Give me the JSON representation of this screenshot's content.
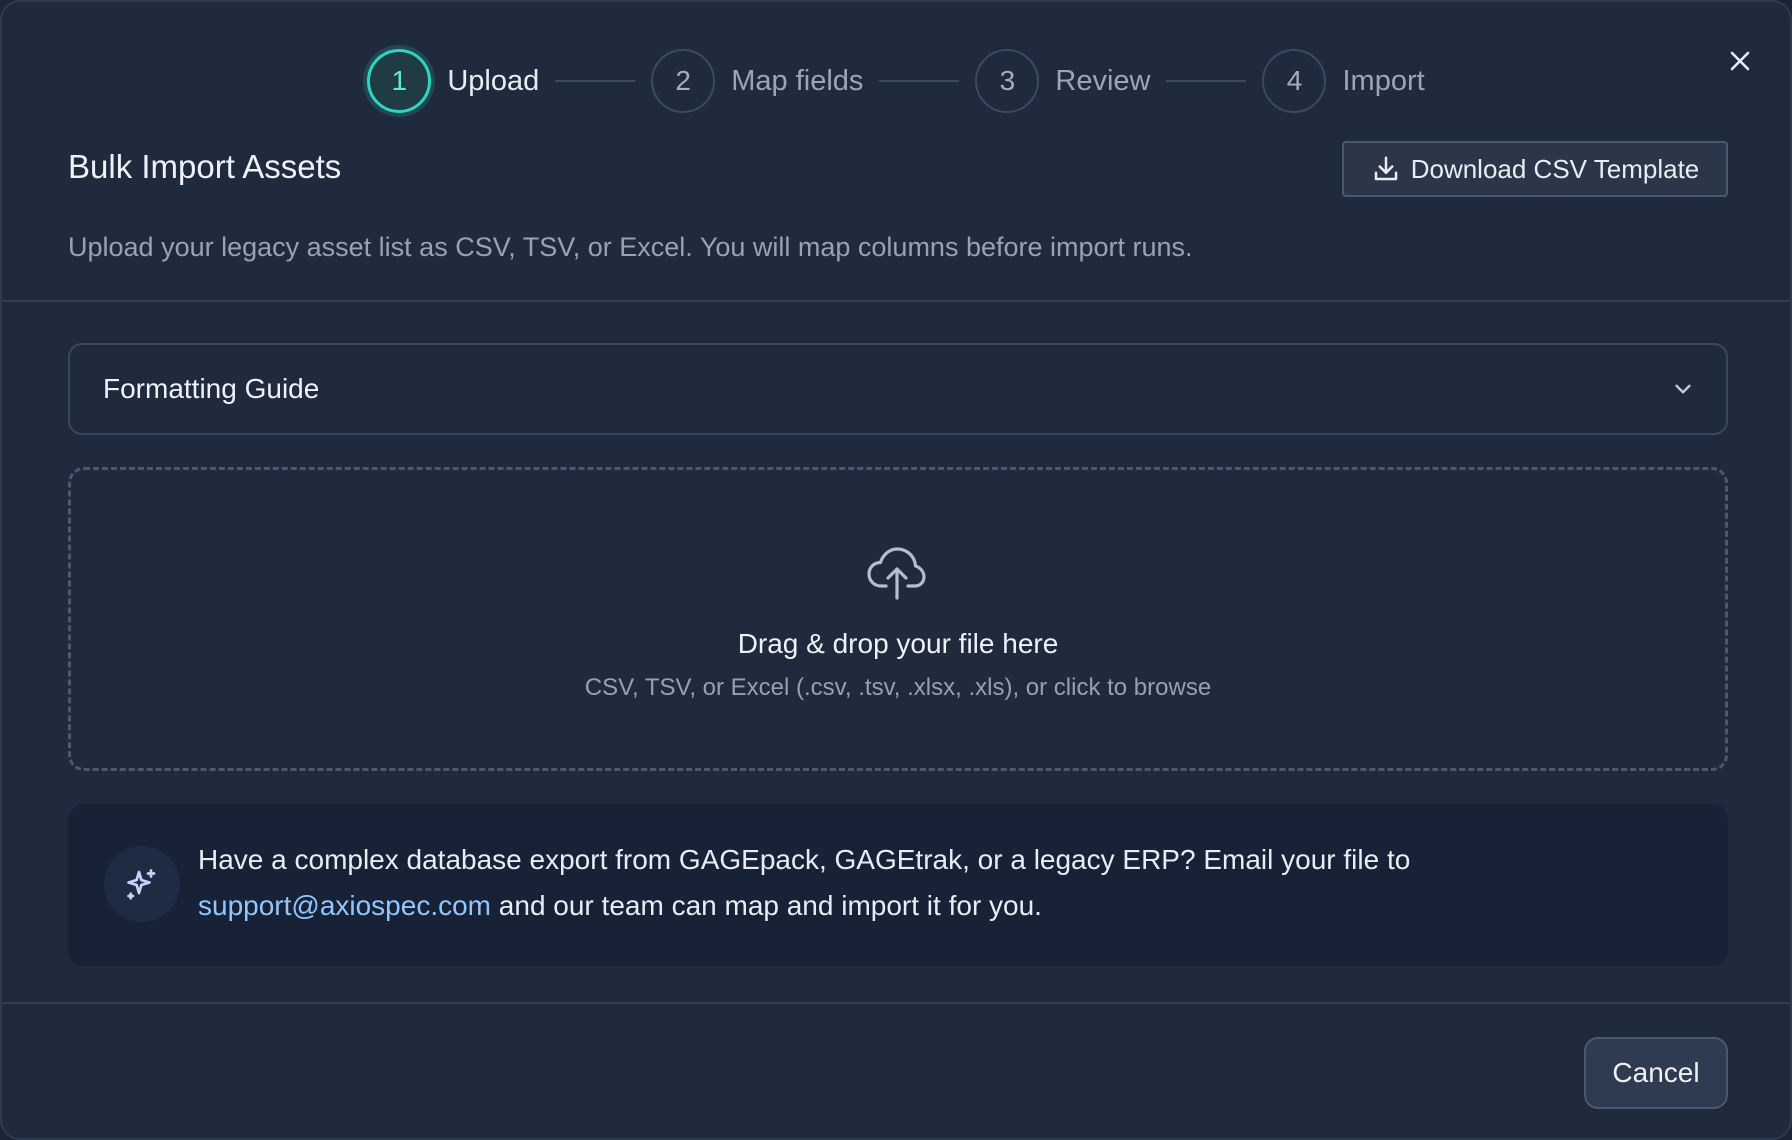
{
  "dialog": {
    "title": "Bulk Import Assets",
    "subtitle": "Upload your legacy asset list as CSV, TSV, or Excel. You will map columns before import runs.",
    "close_icon": "close-icon"
  },
  "stepper": {
    "accent_color": "#2dd4bf",
    "active_step": 1,
    "steps": [
      {
        "number": "1",
        "label": "Upload"
      },
      {
        "number": "2",
        "label": "Map fields"
      },
      {
        "number": "3",
        "label": "Review"
      },
      {
        "number": "4",
        "label": "Import"
      }
    ]
  },
  "toolbar": {
    "download_label": "Download CSV Template",
    "download_icon": "download-icon"
  },
  "guide": {
    "label": "Formatting Guide",
    "icon": "chevron-down-icon"
  },
  "dropzone": {
    "icon": "cloud-upload-icon",
    "title": "Drag & drop your file here",
    "subtitle": "CSV, TSV, or Excel (.csv, .tsv, .xlsx, .xls), or click to browse"
  },
  "callout": {
    "icon": "sparkle-icon",
    "text_before": "Have a complex database export from GAGEpack, GAGEtrak, or a legacy ERP? Email your file to ",
    "email": "support@axiospec.com",
    "text_after": " and our team can map and import it for you.",
    "link_color": "#93c5fd"
  },
  "footer": {
    "cancel_label": "Cancel"
  }
}
